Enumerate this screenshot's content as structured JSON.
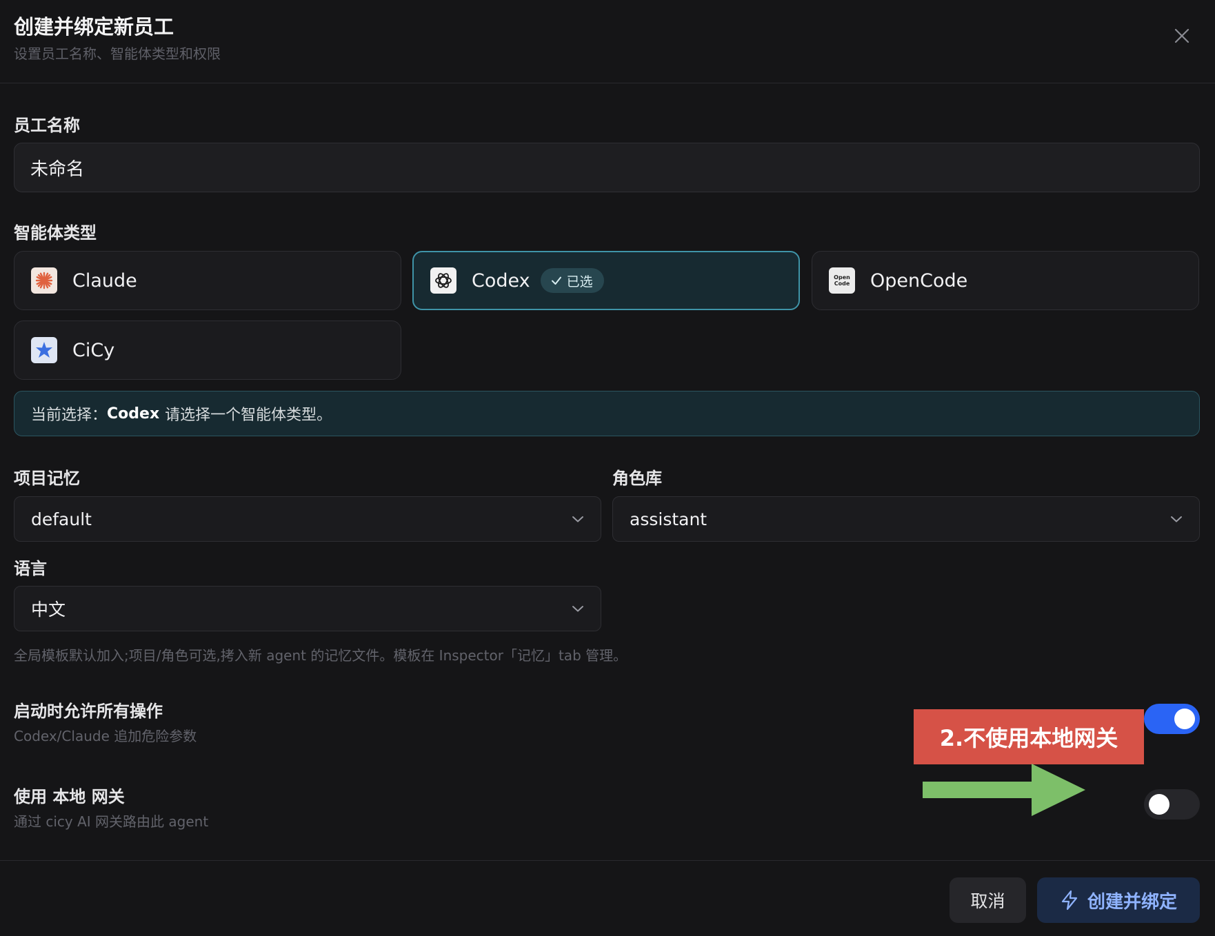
{
  "dialog": {
    "title": "创建并绑定新员工",
    "subtitle": "设置员工名称、智能体类型和权限"
  },
  "name_field": {
    "label": "员工名称",
    "value": "未命名"
  },
  "agent_type": {
    "label": "智能体类型",
    "options": [
      {
        "name": "Claude",
        "icon": "claude-icon",
        "selected": false
      },
      {
        "name": "Codex",
        "icon": "openai-icon",
        "selected": true
      },
      {
        "name": "OpenCode",
        "icon": "opencode-icon",
        "selected": false
      },
      {
        "name": "CiCy",
        "icon": "cicy-icon",
        "selected": false
      }
    ],
    "selected_badge": "已选",
    "opencode_icon_text_1": "Open",
    "opencode_icon_text_2": "Code"
  },
  "selection_info": {
    "prefix": "当前选择：",
    "value": "Codex",
    "suffix": "请选择一个智能体类型。"
  },
  "project_memory": {
    "label": "项目记忆",
    "value": "default"
  },
  "role_library": {
    "label": "角色库",
    "value": "assistant"
  },
  "language": {
    "label": "语言",
    "value": "中文"
  },
  "helper_text": "全局模板默认加入;项目/角色可选,拷入新 agent 的记忆文件。模板在 Inspector「记忆」tab 管理。",
  "allow_all": {
    "title": "启动时允许所有操作",
    "description": "Codex/Claude 追加危险参数",
    "enabled": true
  },
  "local_gateway": {
    "title": "使用 本地 网关",
    "description": "通过 cicy AI 网关路由此 agent",
    "enabled": false
  },
  "annotation": {
    "text": "2.不使用本地网关",
    "box_color": "#d65247",
    "arrow_color": "#7dbf69"
  },
  "footer": {
    "cancel_label": "取消",
    "submit_label": "创建并绑定"
  },
  "colors": {
    "accent_toggle": "#2a64f5",
    "selected_border": "#3f94a8",
    "primary_text": "#8fb3ff"
  }
}
